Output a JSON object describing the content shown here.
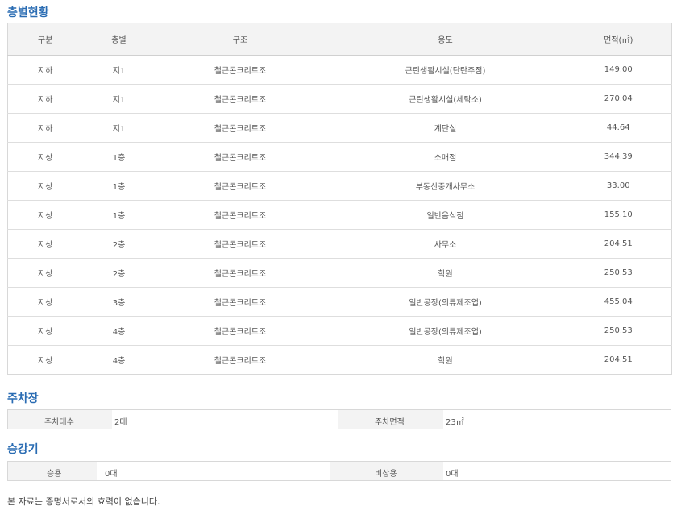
{
  "floor_status": {
    "title": "층별현황",
    "columns": [
      "구분",
      "층별",
      "구조",
      "용도",
      "면적(㎡)"
    ],
    "rows": [
      [
        "지하",
        "지1",
        "철근콘크리트조",
        "근린생활시설(단란주점)",
        "149.00"
      ],
      [
        "지하",
        "지1",
        "철근콘크리트조",
        "근린생활시설(세탁소)",
        "270.04"
      ],
      [
        "지하",
        "지1",
        "철근콘크리트조",
        "계단실",
        "44.64"
      ],
      [
        "지상",
        "1층",
        "철근콘크리트조",
        "소매점",
        "344.39"
      ],
      [
        "지상",
        "1층",
        "철근콘크리트조",
        "부동산중개사무소",
        "33.00"
      ],
      [
        "지상",
        "1층",
        "철근콘크리트조",
        "일반음식점",
        "155.10"
      ],
      [
        "지상",
        "2층",
        "철근콘크리트조",
        "사무소",
        "204.51"
      ],
      [
        "지상",
        "2층",
        "철근콘크리트조",
        "학원",
        "250.53"
      ],
      [
        "지상",
        "3층",
        "철근콘크리트조",
        "일반공장(의류제조업)",
        "455.04"
      ],
      [
        "지상",
        "4층",
        "철근콘크리트조",
        "일반공장(의류제조업)",
        "250.53"
      ],
      [
        "지상",
        "4층",
        "철근콘크리트조",
        "학원",
        "204.51"
      ]
    ]
  },
  "parking": {
    "title": "주차장",
    "count_label": "주차대수",
    "count_value": "2대",
    "area_label": "주차면적",
    "area_value": "23㎡"
  },
  "elevator": {
    "title": "승강기",
    "passenger_label": "승용",
    "passenger_value": "0대",
    "emergency_label": "비상용",
    "emergency_value": "0대"
  },
  "footnote": "본 자료는 증명서로서의 효력이 없습니다."
}
